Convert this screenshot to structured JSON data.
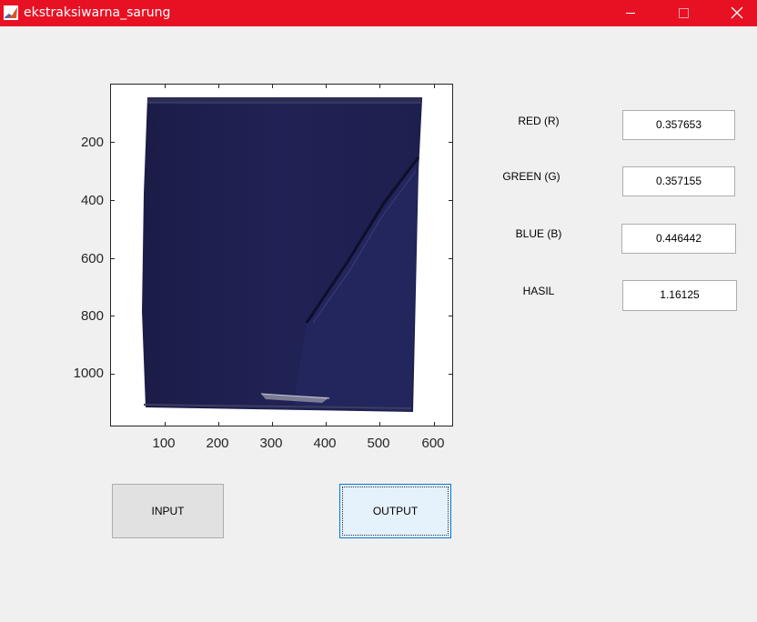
{
  "window": {
    "title": "ekstraksiwarna_sarung",
    "titlebar_color": "#e81123",
    "controls": [
      "minimize-icon",
      "maximize-icon",
      "close-icon"
    ]
  },
  "axes": {
    "yticks": [
      "200",
      "400",
      "600",
      "800",
      "1000"
    ],
    "xticks": [
      "100",
      "200",
      "300",
      "400",
      "500",
      "600"
    ],
    "image_description": "navy blue sarung fabric",
    "fabric_color": "#1f2150"
  },
  "fields": [
    {
      "label": "RED (R)",
      "value": "0.357653"
    },
    {
      "label": "GREEN (G)",
      "value": "0.357155"
    },
    {
      "label": "BLUE (B)",
      "value": "0.446442"
    },
    {
      "label": "HASIL",
      "value": "1.16125"
    }
  ],
  "buttons": {
    "input_label": "INPUT",
    "output_label": "OUTPUT"
  }
}
